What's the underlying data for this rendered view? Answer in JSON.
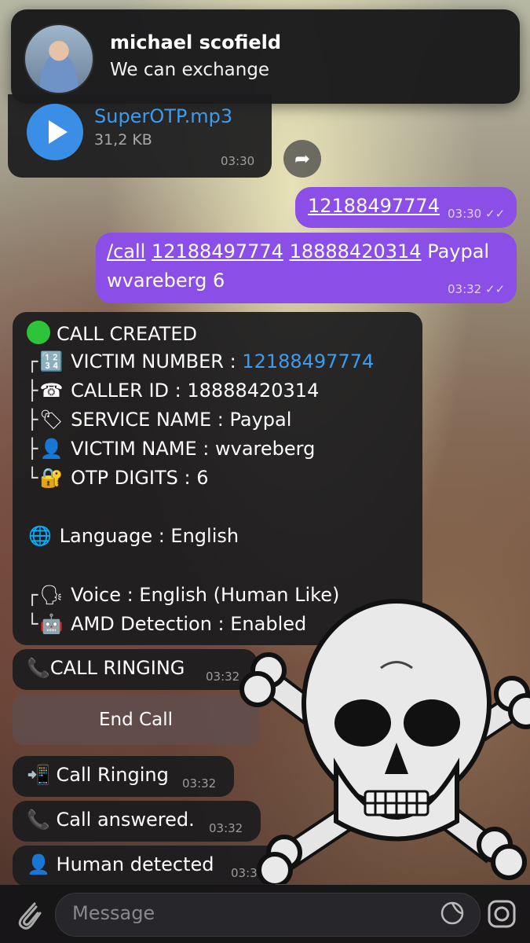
{
  "notification": {
    "name": "michael scofield",
    "message": "We can exchange"
  },
  "audio_message": {
    "file_name": "SuperOTP.mp3",
    "file_size": "31,2 KB",
    "time": "03:30"
  },
  "outgoing": [
    {
      "text": "12188497774",
      "time": "03:30"
    },
    {
      "line1_cmd": "/call",
      "line1_num1": "12188497774",
      "line1_num2": "18888420314",
      "line1_rest": "Paypal",
      "line2": "wvareberg  6",
      "time": "03:32"
    }
  ],
  "call_created": {
    "header": "CALL CREATED",
    "victim_number_label": "VICTIM NUMBER  : ",
    "victim_number": "12188497774",
    "caller_id": "CALLER ID  : 18888420314",
    "service_name": "SERVICE NAME  : Paypal",
    "victim_name": "VICTIM NAME  : wvareberg",
    "otp_digits": "OTP DIGITS : 6",
    "language": "Language : English",
    "voice": "Voice : English (Human Like)",
    "amd": "AMD Detection : Enabled"
  },
  "call_ringing_bubble": {
    "text": "CALL RINGING",
    "time": "03:32"
  },
  "end_call_button": "End Call",
  "status_messages": [
    {
      "text": "Call Ringing",
      "time": "03:32"
    },
    {
      "text": "Call answered.",
      "time": "03:32"
    },
    {
      "text": "Human detected",
      "time": "03:32"
    }
  ],
  "input": {
    "placeholder": "Message"
  },
  "colors": {
    "outgoing_bubble": "#8b4ee6",
    "link_blue": "#3b9cf0",
    "play_button": "#3a8ee6"
  }
}
